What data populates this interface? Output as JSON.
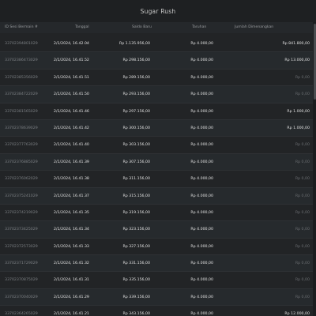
{
  "window": {
    "title": "Sugar Rush"
  },
  "table": {
    "headers": {
      "id": "ID Sesi Bermain #",
      "date": "Tanggal",
      "saldo": "Saldo Baru",
      "bet": "Taruhan",
      "win": "Jumlah Dimenangkan"
    },
    "rows": [
      {
        "id": "33702394801029",
        "date": "2/1/2024, 16.42.04",
        "saldo": "Rp 1.135.956,00",
        "bet": "Rp 4.000,00",
        "win": "Rp 841.800,00"
      },
      {
        "id": "33702386473029",
        "date": "2/1/2024, 16.41.52",
        "saldo": "Rp 298.156,00",
        "bet": "Rp 4.000,00",
        "win": "Rp 13.000,00"
      },
      {
        "id": "33702385356029",
        "date": "2/1/2024, 16.41.51",
        "saldo": "Rp 289.156,00",
        "bet": "Rp 4.000,00",
        "win": "Rp 0,00"
      },
      {
        "id": "33702384722029",
        "date": "2/1/2024, 16.41.50",
        "saldo": "Rp 293.156,00",
        "bet": "Rp 4.000,00",
        "win": "Rp 0,00"
      },
      {
        "id": "33702381565029",
        "date": "2/1/2024, 16.41.46",
        "saldo": "Rp 297.156,00",
        "bet": "Rp 4.000,00",
        "win": "Rp 1.000,00"
      },
      {
        "id": "33702378639029",
        "date": "2/1/2024, 16.41.42",
        "saldo": "Rp 300.156,00",
        "bet": "Rp 4.000,00",
        "win": "Rp 1.000,00"
      },
      {
        "id": "33702377763029",
        "date": "2/1/2024, 16.41.40",
        "saldo": "Rp 303.156,00",
        "bet": "Rp 4.000,00",
        "win": "Rp 0,00"
      },
      {
        "id": "33702376885029",
        "date": "2/1/2024, 16.41.39",
        "saldo": "Rp 307.156,00",
        "bet": "Rp 4.000,00",
        "win": "Rp 0,00"
      },
      {
        "id": "33702376062029",
        "date": "2/1/2024, 16.41.38",
        "saldo": "Rp 311.156,00",
        "bet": "Rp 4.000,00",
        "win": "Rp 0,00"
      },
      {
        "id": "33702375241029",
        "date": "2/1/2024, 16.41.37",
        "saldo": "Rp 315.156,00",
        "bet": "Rp 4.000,00",
        "win": "Rp 0,00"
      },
      {
        "id": "33702374219029",
        "date": "2/1/2024, 16.41.35",
        "saldo": "Rp 319.156,00",
        "bet": "Rp 4.000,00",
        "win": "Rp 0,00"
      },
      {
        "id": "33702373425029",
        "date": "2/1/2024, 16.41.34",
        "saldo": "Rp 323.156,00",
        "bet": "Rp 4.000,00",
        "win": "Rp 0,00"
      },
      {
        "id": "33702372573029",
        "date": "2/1/2024, 16.41.33",
        "saldo": "Rp 327.156,00",
        "bet": "Rp 4.000,00",
        "win": "Rp 0,00"
      },
      {
        "id": "33702371729029",
        "date": "2/1/2024, 16.41.32",
        "saldo": "Rp 331.156,00",
        "bet": "Rp 4.000,00",
        "win": "Rp 0,00"
      },
      {
        "id": "33702370875029",
        "date": "2/1/2024, 16.41.31",
        "saldo": "Rp 335.156,00",
        "bet": "Rp 4.000,00",
        "win": "Rp 0,00"
      },
      {
        "id": "33702370040029",
        "date": "2/1/2024, 16.41.29",
        "saldo": "Rp 339.156,00",
        "bet": "Rp 4.000,00",
        "win": "Rp 0,00"
      },
      {
        "id": "33702364265029",
        "date": "2/1/2024, 16.41.21",
        "saldo": "Rp 343.156,00",
        "bet": "Rp 4.000,00",
        "win": "Rp 12.000,00"
      }
    ]
  }
}
